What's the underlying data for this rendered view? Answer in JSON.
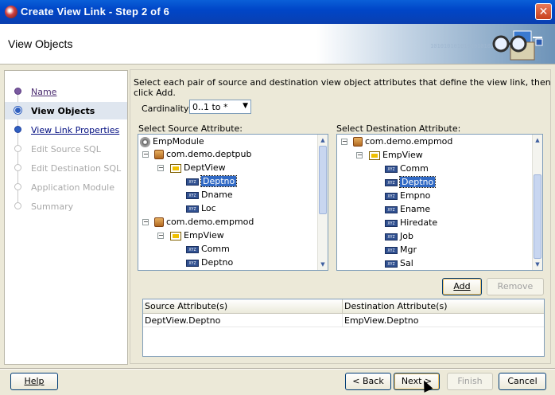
{
  "window": {
    "title": "Create View Link - Step 2 of 6",
    "close_glyph": "✕"
  },
  "header": {
    "page_title": "View Objects",
    "bits": "10101010101010101010101"
  },
  "steps": [
    {
      "label": "Name",
      "state": "done"
    },
    {
      "label": "View Objects",
      "state": "current"
    },
    {
      "label": "View Link Properties",
      "state": "link"
    },
    {
      "label": "Edit Source SQL",
      "state": "disabled"
    },
    {
      "label": "Edit Destination SQL",
      "state": "disabled"
    },
    {
      "label": "Application Module",
      "state": "disabled"
    },
    {
      "label": "Summary",
      "state": "disabled"
    }
  ],
  "main": {
    "instruction": "Select each pair of source and destination view object attributes that define the view link, then click Add.",
    "cardinality_label": "Cardinality:",
    "cardinality_value": "0..1 to *",
    "source_label": "Select Source Attribute:",
    "destination_label": "Select Destination Attribute:"
  },
  "source_tree": {
    "root": "EmpModule",
    "pkg1": "com.demo.deptpub",
    "view1": "DeptView",
    "attrs1": [
      "Deptno",
      "Dname",
      "Loc"
    ],
    "pkg2": "com.demo.empmod",
    "view2": "EmpView",
    "attrs2": [
      "Comm",
      "Deptno"
    ],
    "selected": "Deptno"
  },
  "destination_tree": {
    "pkg": "com.demo.empmod",
    "view": "EmpView",
    "attrs": [
      "Comm",
      "Deptno",
      "Empno",
      "Ename",
      "Hiredate",
      "Job",
      "Mgr",
      "Sal"
    ],
    "selected": "Deptno"
  },
  "buttons": {
    "add": "Add",
    "remove": "Remove",
    "help": "Help",
    "back": "< Back",
    "next": "Next >",
    "finish": "Finish",
    "cancel": "Cancel"
  },
  "pairs_table": {
    "headers": [
      "Source Attribute(s)",
      "Destination Attribute(s)"
    ],
    "rows": [
      [
        "DeptView.Deptno",
        "EmpView.Deptno"
      ]
    ]
  },
  "icons": {
    "attr_badge": "XYZ"
  },
  "colors": {
    "title_bar": "#0a4fd0",
    "selection": "#316ac5"
  }
}
